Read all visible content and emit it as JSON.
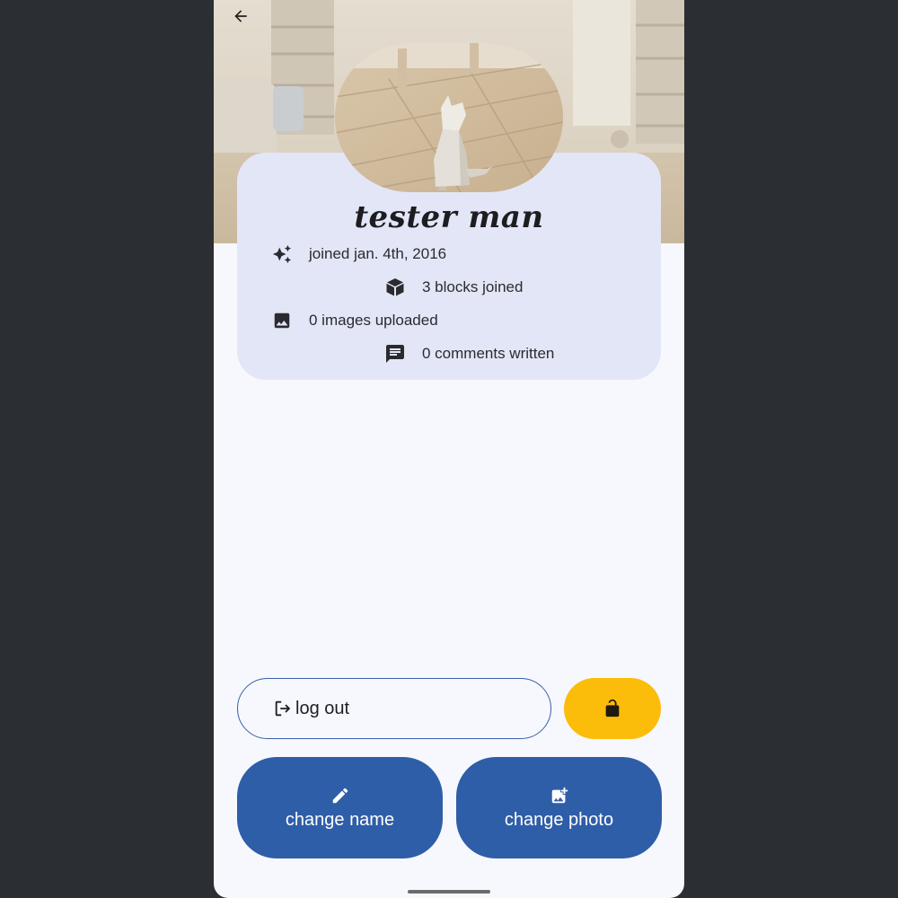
{
  "header": {
    "back_icon": "arrow-left-icon",
    "cover_image": "living-room-photo",
    "avatar_image": "low-poly-cat-photo"
  },
  "profile": {
    "name": "tester man",
    "stats": [
      {
        "icon": "sparkle-icon",
        "label": "joined jan. 4th, 2016"
      },
      {
        "icon": "cube-icon",
        "label": "3 blocks joined"
      },
      {
        "icon": "image-icon",
        "label": "0 images uploaded"
      },
      {
        "icon": "comment-icon",
        "label": "0 comments written"
      }
    ]
  },
  "actions": {
    "logout_label": "log out",
    "logout_icon": "logout-icon",
    "lock_icon": "lock-open-icon",
    "change_name_label": "change name",
    "change_name_icon": "pencil-icon",
    "change_photo_label": "change photo",
    "change_photo_icon": "add-photo-icon"
  },
  "colors": {
    "card_bg": "#e3e6f6",
    "primary": "#2f5ea8",
    "accent": "#fbbd0a",
    "page_bg": "#f7f8fe"
  }
}
